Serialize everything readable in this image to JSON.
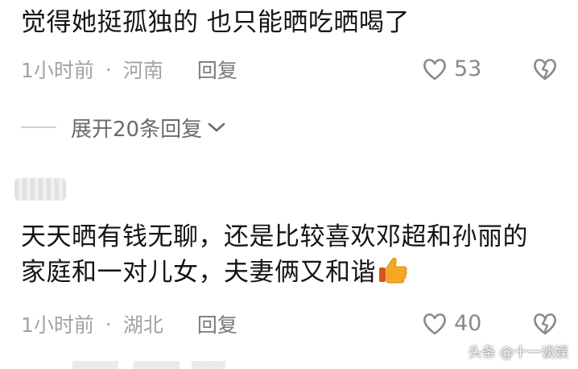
{
  "comment1": {
    "text": "觉得她挺孤独的 也只能晒吃晒喝了",
    "time": "1小时前",
    "location": "河南",
    "reply_label": "回复",
    "likes": "53"
  },
  "expand": {
    "label": "展开20条回复"
  },
  "comment2": {
    "text": "天天晒有钱无聊，还是比较喜欢邓超和孙丽的家庭和一对儿女，夫妻俩又和谐",
    "time": "1小时前",
    "location": "湖北",
    "reply_label": "回复",
    "likes": "40"
  },
  "separator_dot": "·",
  "watermark": "头条 @十一谈娱",
  "icons": {
    "like": "heart-outline-icon",
    "dislike": "broken-heart-icon",
    "expand": "chevron-down-icon",
    "emoji": "thumbs-up-emoji-icon"
  },
  "colors": {
    "text": "#141414",
    "meta": "#a3a3a3",
    "accent_emoji": "#f5a623"
  }
}
